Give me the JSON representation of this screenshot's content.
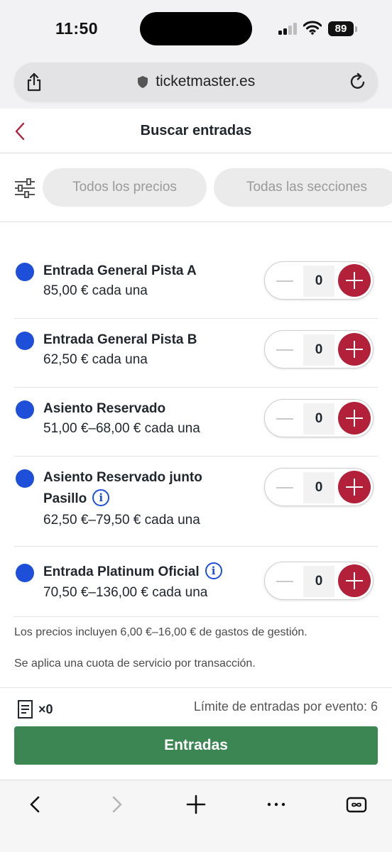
{
  "status_bar": {
    "time": "11:50",
    "battery": "89"
  },
  "browser": {
    "url": "ticketmaster.es"
  },
  "header": {
    "title": "Buscar entradas"
  },
  "filters": {
    "price": "Todos los precios",
    "section": "Todas las secciones"
  },
  "tickets": [
    {
      "name": "Entrada General Pista A",
      "price": "85,00 € cada una",
      "qty": "0"
    },
    {
      "name": "Entrada General Pista B",
      "price": "62,50 € cada una",
      "qty": "0"
    },
    {
      "name": "Asiento Reservado",
      "price": "51,00 €–68,00 € cada una",
      "qty": "0"
    },
    {
      "name_line1": "Asiento Reservado junto",
      "name_line2": "Pasillo",
      "price": "62,50 €–79,50 € cada una",
      "qty": "0"
    },
    {
      "name": "Entrada Platinum Oficial",
      "price": "70,50 €–136,00 € cada una",
      "qty": "0"
    }
  ],
  "notes": {
    "fees": "Los precios incluyen 6,00 €–16,00 € de gastos de gestión.",
    "service": "Se aplica una cuota de servicio por transacción."
  },
  "footer": {
    "count": "×0",
    "limit": "Límite de entradas por evento: 6",
    "cta": "Entradas"
  },
  "colors": {
    "accent_red": "#b3203a",
    "dot_blue": "#1e4fd8",
    "cta_green": "#3c8653"
  }
}
